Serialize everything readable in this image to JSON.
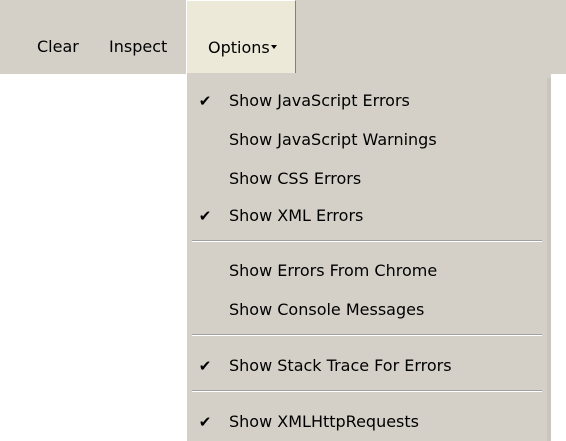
{
  "toolbar": {
    "clear_label": "Clear",
    "inspect_label": "Inspect",
    "options_label": "Options"
  },
  "menu": {
    "items": [
      {
        "label": "Show JavaScript Errors",
        "checked": true
      },
      {
        "label": "Show JavaScript Warnings",
        "checked": false
      },
      {
        "label": "Show CSS Errors",
        "checked": false
      },
      {
        "label": "Show XML Errors",
        "checked": true
      },
      {
        "label": "Show Errors From Chrome",
        "checked": false
      },
      {
        "label": "Show Console Messages",
        "checked": false
      },
      {
        "label": "Show Stack Trace For Errors",
        "checked": true
      },
      {
        "label": "Show XMLHttpRequests",
        "checked": true
      }
    ],
    "check_glyph": "✔"
  }
}
